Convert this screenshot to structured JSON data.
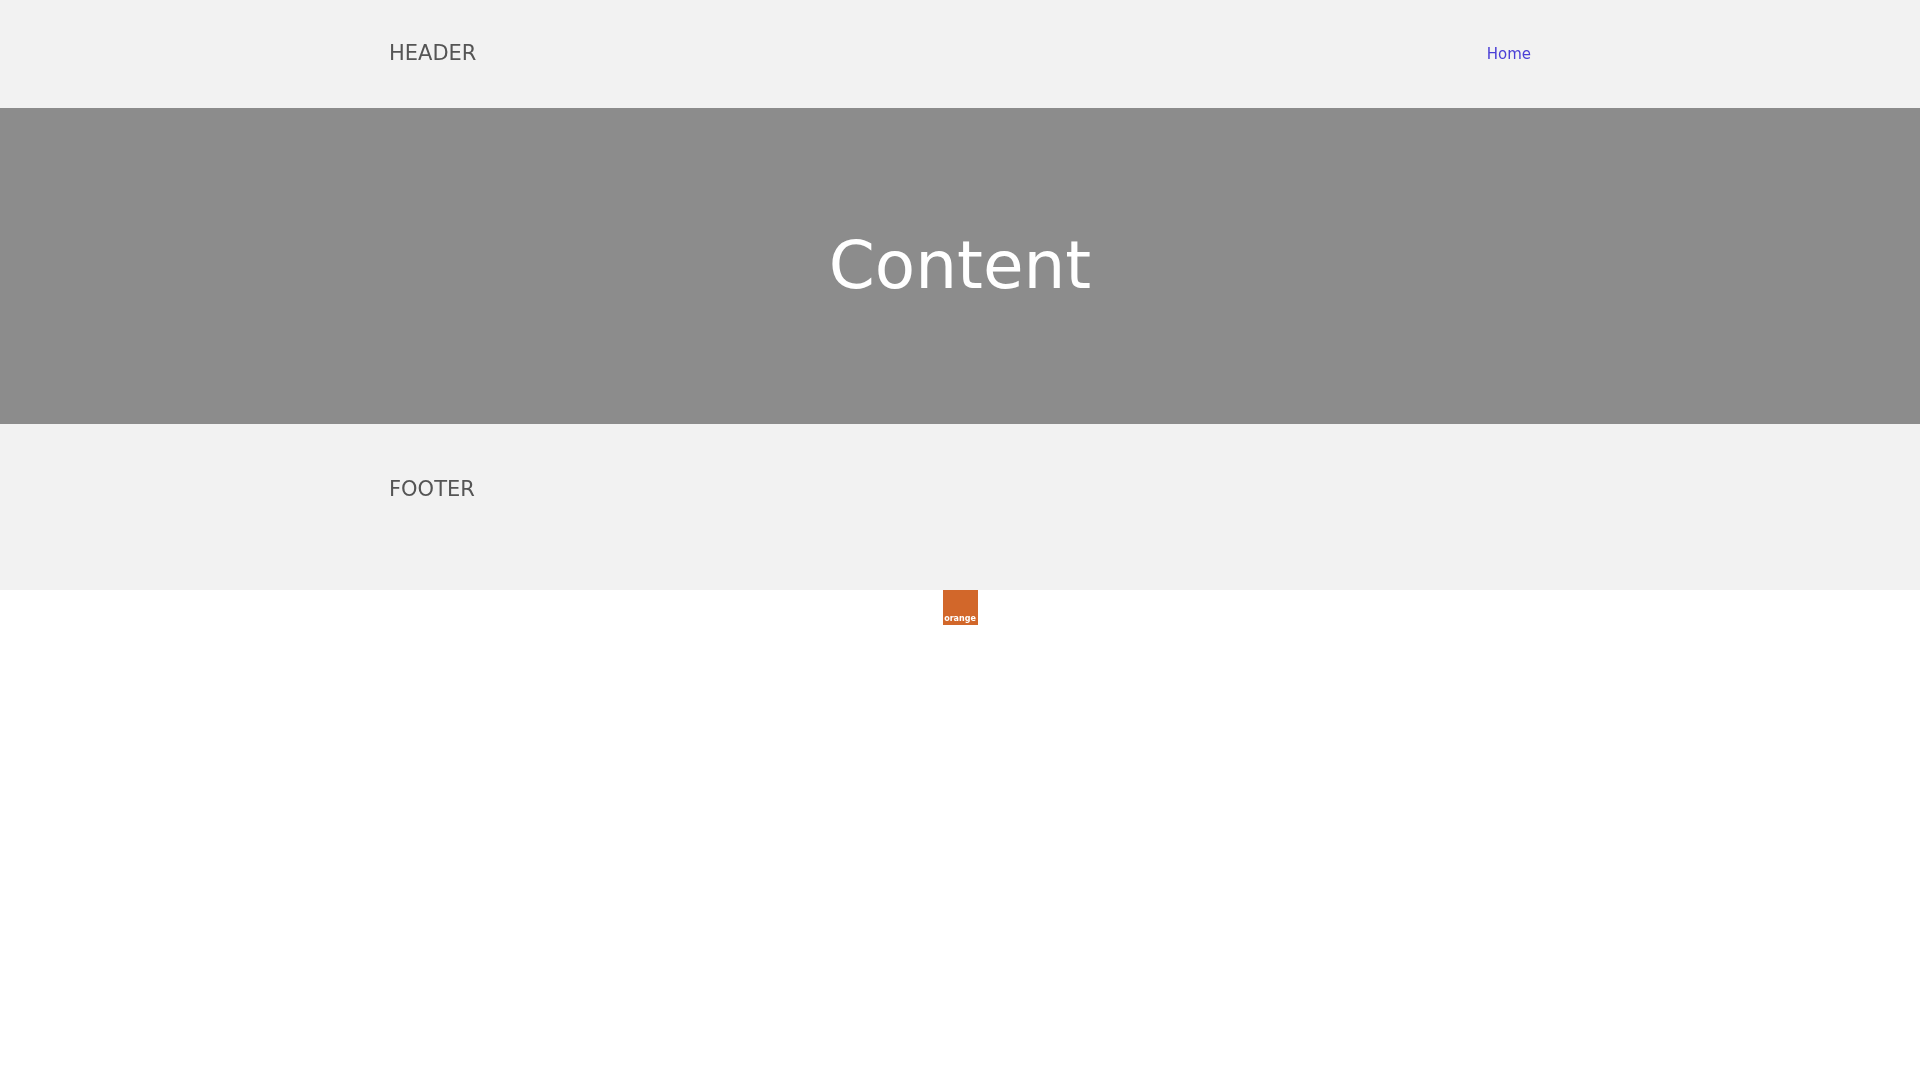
{
  "header": {
    "title": "HEADER",
    "nav": [
      {
        "label": "Home"
      }
    ]
  },
  "hero": {
    "title": "Content"
  },
  "footer": {
    "title": "FOOTER"
  },
  "logo": {
    "text": "orange"
  }
}
